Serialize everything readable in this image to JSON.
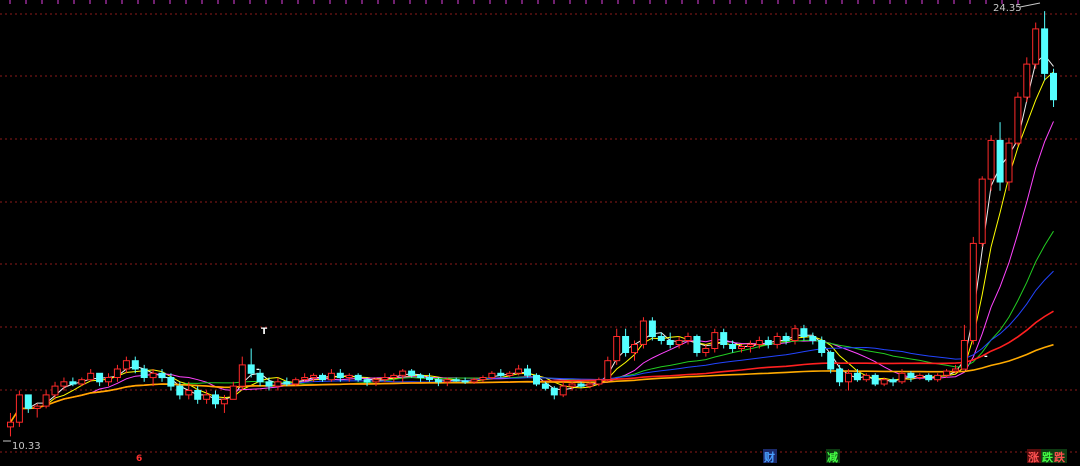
{
  "chart_data": {
    "type": "candlestick",
    "price_labels": {
      "high": "24.35",
      "low": "10.33"
    },
    "ylim": [
      10.0,
      24.7
    ],
    "grid": "horizontal dashed",
    "colors": {
      "up": "#ff2a2a",
      "down": "#54ffff",
      "flat": "#ffffff",
      "grid": "#8b1a1a",
      "ma": [
        "#f0f0f0",
        "#ffff00",
        "#ff44ff",
        "#22cc22",
        "#2244ff",
        "#ff2020",
        "#ffaa00"
      ]
    },
    "candles": [
      [
        10.6,
        10.9,
        10.4,
        10.7
      ],
      [
        10.7,
        11.4,
        10.6,
        11.3
      ],
      [
        11.3,
        11.3,
        10.9,
        11.0
      ],
      [
        11.0,
        11.1,
        10.8,
        11.05
      ],
      [
        11.05,
        11.4,
        11.0,
        11.3
      ],
      [
        11.3,
        11.6,
        11.2,
        11.5
      ],
      [
        11.5,
        11.7,
        11.4,
        11.6
      ],
      [
        11.6,
        11.7,
        11.5,
        11.55
      ],
      [
        11.55,
        11.7,
        11.5,
        11.65
      ],
      [
        11.65,
        11.9,
        11.6,
        11.8
      ],
      [
        11.8,
        11.8,
        11.5,
        11.6
      ],
      [
        11.6,
        11.8,
        11.5,
        11.7
      ],
      [
        11.7,
        12.0,
        11.6,
        11.9
      ],
      [
        11.9,
        12.2,
        11.8,
        12.1
      ],
      [
        12.1,
        12.2,
        11.8,
        11.9
      ],
      [
        11.9,
        12.0,
        11.6,
        11.7
      ],
      [
        11.7,
        11.9,
        11.5,
        11.8
      ],
      [
        11.8,
        11.9,
        11.6,
        11.7
      ],
      [
        11.7,
        11.8,
        11.4,
        11.5
      ],
      [
        11.5,
        11.6,
        11.2,
        11.3
      ],
      [
        11.3,
        11.6,
        11.2,
        11.4
      ],
      [
        11.4,
        11.5,
        11.1,
        11.2
      ],
      [
        11.2,
        11.4,
        11.1,
        11.3
      ],
      [
        11.3,
        11.4,
        11.0,
        11.1
      ],
      [
        11.1,
        11.3,
        10.9,
        11.2
      ],
      [
        11.2,
        11.6,
        11.2,
        11.5
      ],
      [
        11.5,
        12.2,
        11.4,
        12.0
      ],
      [
        12.0,
        12.4,
        11.7,
        11.8
      ],
      [
        11.8,
        11.9,
        11.5,
        11.6
      ],
      [
        11.6,
        11.7,
        11.4,
        11.5
      ],
      [
        11.5,
        11.7,
        11.4,
        11.6
      ],
      [
        11.6,
        11.7,
        11.5,
        11.55
      ],
      [
        11.55,
        11.7,
        11.5,
        11.65
      ],
      [
        11.65,
        11.8,
        11.6,
        11.7
      ],
      [
        11.7,
        11.8,
        11.6,
        11.75
      ],
      [
        11.75,
        11.8,
        11.6,
        11.65
      ],
      [
        11.65,
        11.9,
        11.6,
        11.8
      ],
      [
        11.8,
        11.9,
        11.6,
        11.7
      ],
      [
        11.7,
        11.8,
        11.6,
        11.75
      ],
      [
        11.75,
        11.8,
        11.6,
        11.65
      ],
      [
        11.65,
        11.7,
        11.5,
        11.6
      ],
      [
        11.6,
        11.7,
        11.5,
        11.65
      ],
      [
        11.65,
        11.8,
        11.6,
        11.7
      ],
      [
        11.7,
        11.8,
        11.6,
        11.75
      ],
      [
        11.75,
        11.9,
        11.6,
        11.85
      ],
      [
        11.85,
        11.9,
        11.7,
        11.75
      ],
      [
        11.75,
        11.8,
        11.6,
        11.7
      ],
      [
        11.7,
        11.8,
        11.6,
        11.65
      ],
      [
        11.65,
        11.7,
        11.5,
        11.6
      ],
      [
        11.6,
        11.7,
        11.5,
        11.65
      ],
      [
        11.65,
        11.7,
        11.6,
        11.62
      ],
      [
        11.62,
        11.7,
        11.55,
        11.6
      ],
      [
        11.6,
        11.7,
        11.55,
        11.65
      ],
      [
        11.65,
        11.75,
        11.6,
        11.7
      ],
      [
        11.7,
        11.85,
        11.65,
        11.8
      ],
      [
        11.8,
        11.9,
        11.7,
        11.75
      ],
      [
        11.75,
        11.85,
        11.7,
        11.8
      ],
      [
        11.8,
        12.0,
        11.75,
        11.9
      ],
      [
        11.9,
        12.0,
        11.7,
        11.75
      ],
      [
        11.75,
        11.8,
        11.5,
        11.55
      ],
      [
        11.55,
        11.6,
        11.4,
        11.45
      ],
      [
        11.45,
        11.5,
        11.2,
        11.3
      ],
      [
        11.3,
        11.6,
        11.25,
        11.5
      ],
      [
        11.5,
        11.6,
        11.4,
        11.55
      ],
      [
        11.55,
        11.6,
        11.45,
        11.5
      ],
      [
        11.5,
        11.6,
        11.45,
        11.55
      ],
      [
        11.55,
        11.7,
        11.5,
        11.65
      ],
      [
        11.65,
        12.2,
        11.6,
        12.1
      ],
      [
        12.1,
        12.9,
        12.0,
        12.7
      ],
      [
        12.7,
        12.9,
        12.2,
        12.3
      ],
      [
        12.3,
        12.6,
        12.1,
        12.5
      ],
      [
        12.5,
        13.2,
        12.4,
        13.1
      ],
      [
        13.1,
        13.2,
        12.6,
        12.7
      ],
      [
        12.7,
        12.8,
        12.5,
        12.6
      ],
      [
        12.6,
        12.8,
        12.4,
        12.5
      ],
      [
        12.5,
        12.7,
        12.4,
        12.6
      ],
      [
        12.6,
        12.8,
        12.5,
        12.7
      ],
      [
        12.7,
        12.75,
        12.2,
        12.3
      ],
      [
        12.3,
        12.5,
        12.2,
        12.4
      ],
      [
        12.4,
        12.9,
        12.3,
        12.8
      ],
      [
        12.8,
        12.9,
        12.4,
        12.5
      ],
      [
        12.5,
        12.6,
        12.3,
        12.4
      ],
      [
        12.4,
        12.5,
        12.3,
        12.45
      ],
      [
        12.45,
        12.6,
        12.3,
        12.5
      ],
      [
        12.5,
        12.7,
        12.4,
        12.6
      ],
      [
        12.6,
        12.7,
        12.4,
        12.5
      ],
      [
        12.5,
        12.8,
        12.4,
        12.7
      ],
      [
        12.7,
        12.8,
        12.5,
        12.6
      ],
      [
        12.6,
        13.0,
        12.5,
        12.9
      ],
      [
        12.9,
        13.0,
        12.6,
        12.7
      ],
      [
        12.7,
        12.8,
        12.5,
        12.6
      ],
      [
        12.6,
        12.7,
        12.2,
        12.3
      ],
      [
        12.3,
        12.35,
        11.8,
        11.9
      ],
      [
        11.9,
        12.0,
        11.5,
        11.6
      ],
      [
        11.6,
        11.9,
        11.4,
        11.8
      ],
      [
        11.8,
        11.9,
        11.6,
        11.65
      ],
      [
        11.65,
        11.8,
        11.6,
        11.75
      ],
      [
        11.75,
        11.8,
        11.5,
        11.55
      ],
      [
        11.55,
        11.7,
        11.5,
        11.65
      ],
      [
        11.65,
        11.7,
        11.5,
        11.6
      ],
      [
        11.6,
        11.9,
        11.55,
        11.8
      ],
      [
        11.8,
        11.85,
        11.6,
        11.7
      ],
      [
        11.7,
        11.8,
        11.65,
        11.75
      ],
      [
        11.75,
        11.8,
        11.6,
        11.65
      ],
      [
        11.65,
        11.8,
        11.6,
        11.75
      ],
      [
        11.75,
        11.9,
        11.7,
        11.85
      ],
      [
        11.85,
        12.0,
        11.8,
        11.9
      ],
      [
        11.9,
        13.0,
        11.9,
        12.6
      ],
      [
        12.6,
        15.5,
        12.5,
        15.3
      ],
      [
        15.3,
        17.5,
        15.2,
        17.4
      ],
      [
        17.4,
        19.0,
        17.0,
        18.8
      ],
      [
        18.8,
        19.5,
        17.0,
        17.3
      ],
      [
        17.3,
        18.9,
        17.0,
        18.7
      ],
      [
        18.7,
        20.7,
        18.6,
        20.5
      ],
      [
        20.5,
        22.2,
        20.3,
        21.9
      ],
      [
        21.9,
        23.8,
        21.7,
        23.5
      ],
      [
        23.5,
        24.35,
        21.2,
        21.5
      ],
      [
        21.5,
        21.7,
        20.1,
        20.4
      ]
    ],
    "ma_periods": [
      3,
      5,
      10,
      20,
      30,
      60,
      120
    ]
  },
  "markers": {
    "bottom_left_flag": "6",
    "cai": "财",
    "jian": "减",
    "zhang": "涨",
    "die": "跌",
    "small_t": "T",
    "dash": "-"
  }
}
